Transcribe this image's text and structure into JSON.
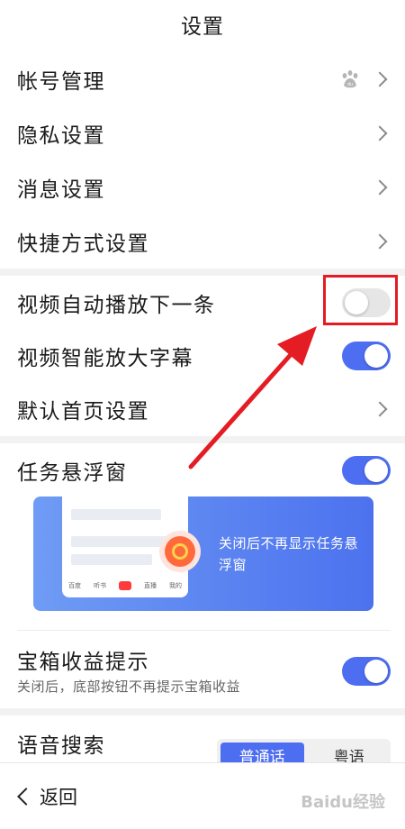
{
  "header": {
    "title": "设置"
  },
  "rows": {
    "account": "帐号管理",
    "privacy": "隐私设置",
    "message": "消息设置",
    "shortcut": "快捷方式设置",
    "autoplay": {
      "label": "视频自动播放下一条",
      "on": false
    },
    "subtitle": {
      "label": "视频智能放大字幕",
      "on": true
    },
    "homepage": "默认首页设置",
    "floating": {
      "label": "任务悬浮窗",
      "on": true
    },
    "treasure": {
      "label": "宝箱收益提示",
      "sub": "关闭后，底部按钮不再提示宝箱收益",
      "on": true
    },
    "voice": {
      "label": "语音搜索",
      "options": [
        "普通话",
        "粤语"
      ],
      "selected": "普通话"
    }
  },
  "banner": {
    "text": "关闭后不再显示任务悬浮窗",
    "tabs": [
      "百度",
      "听书",
      "直播",
      "我的"
    ]
  },
  "footer": {
    "back_label": "返回"
  },
  "colors": {
    "accent": "#4e6ef2",
    "highlight": "#e41c23"
  },
  "watermark": "Baidu经验"
}
